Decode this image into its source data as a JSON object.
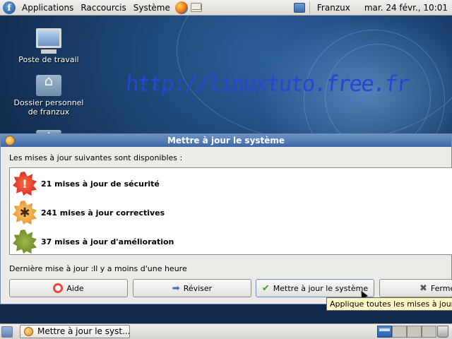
{
  "top_panel": {
    "menus": [
      "Applications",
      "Raccourcis",
      "Système"
    ],
    "user": "Franzux",
    "clock": "mar. 24 févr., 10:01",
    "icons": [
      "fedora-logo-icon",
      "firefox-icon",
      "mail-icon",
      "network-icon"
    ]
  },
  "desktop": {
    "icons": [
      {
        "label": "Poste de travail",
        "icon": "computer-icon"
      },
      {
        "label": "Dossier personnel de franzux",
        "icon": "home-folder-icon"
      }
    ],
    "watermark": "http://linuxtuto.free.fr"
  },
  "dialog": {
    "title": "Mettre à jour le système",
    "intro": "Les mises à jour suivantes sont disponibles :",
    "updates": [
      {
        "label": "21 mises à jour de sécurité",
        "icon": "security-update-icon",
        "symbol": "!"
      },
      {
        "label": "241 mises à jour correctives",
        "icon": "bugfix-update-icon",
        "symbol": "✱"
      },
      {
        "label": "37 mises à jour d'amélioration",
        "icon": "enhancement-update-icon",
        "symbol": ""
      }
    ],
    "last_update_label": "Dernière mise à jour :",
    "last_update_value": "Il y a moins d'une heure",
    "buttons": {
      "help": "Aide",
      "review": "Réviser",
      "apply": "Mettre à jour le système",
      "close": "Ferme"
    },
    "tooltip": "Applique toutes les mises à jour"
  },
  "bottom_panel": {
    "task": "Mettre à jour le syst...",
    "workspaces": 4,
    "active_workspace": 1
  }
}
